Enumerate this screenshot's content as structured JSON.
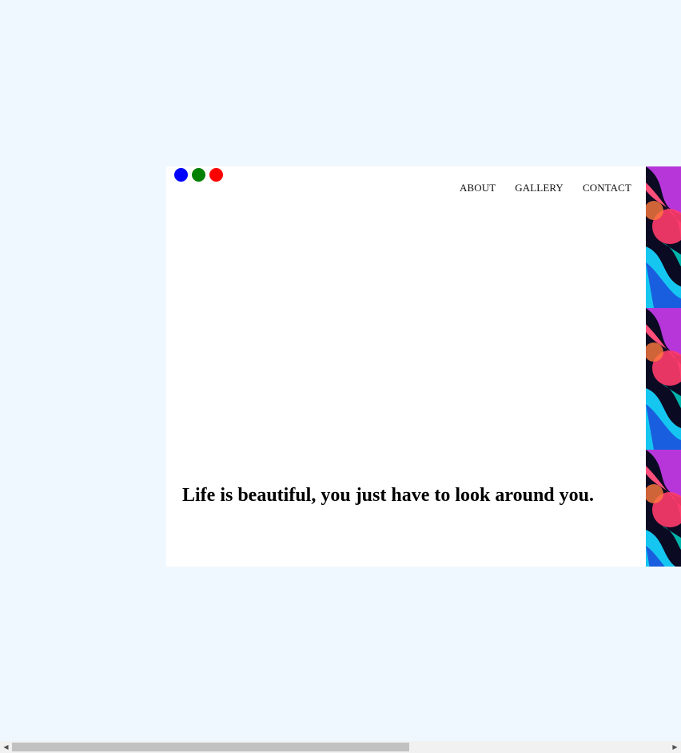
{
  "window_dots": [
    {
      "name": "blue-dot",
      "color": "#0000ff"
    },
    {
      "name": "green-dot",
      "color": "#008000"
    },
    {
      "name": "red-dot",
      "color": "#ff0000"
    }
  ],
  "nav": {
    "about": "ABOUT",
    "gallery": "GALLERY",
    "contact": "CONTACT"
  },
  "hero": {
    "headline": "Life is beautiful, you just have to look around you."
  },
  "colors": {
    "page_background": "#eff8fe",
    "card_background": "#ffffff"
  },
  "scrollbar": {
    "left_arrow_icon": "◀",
    "right_arrow_icon": "▶"
  }
}
